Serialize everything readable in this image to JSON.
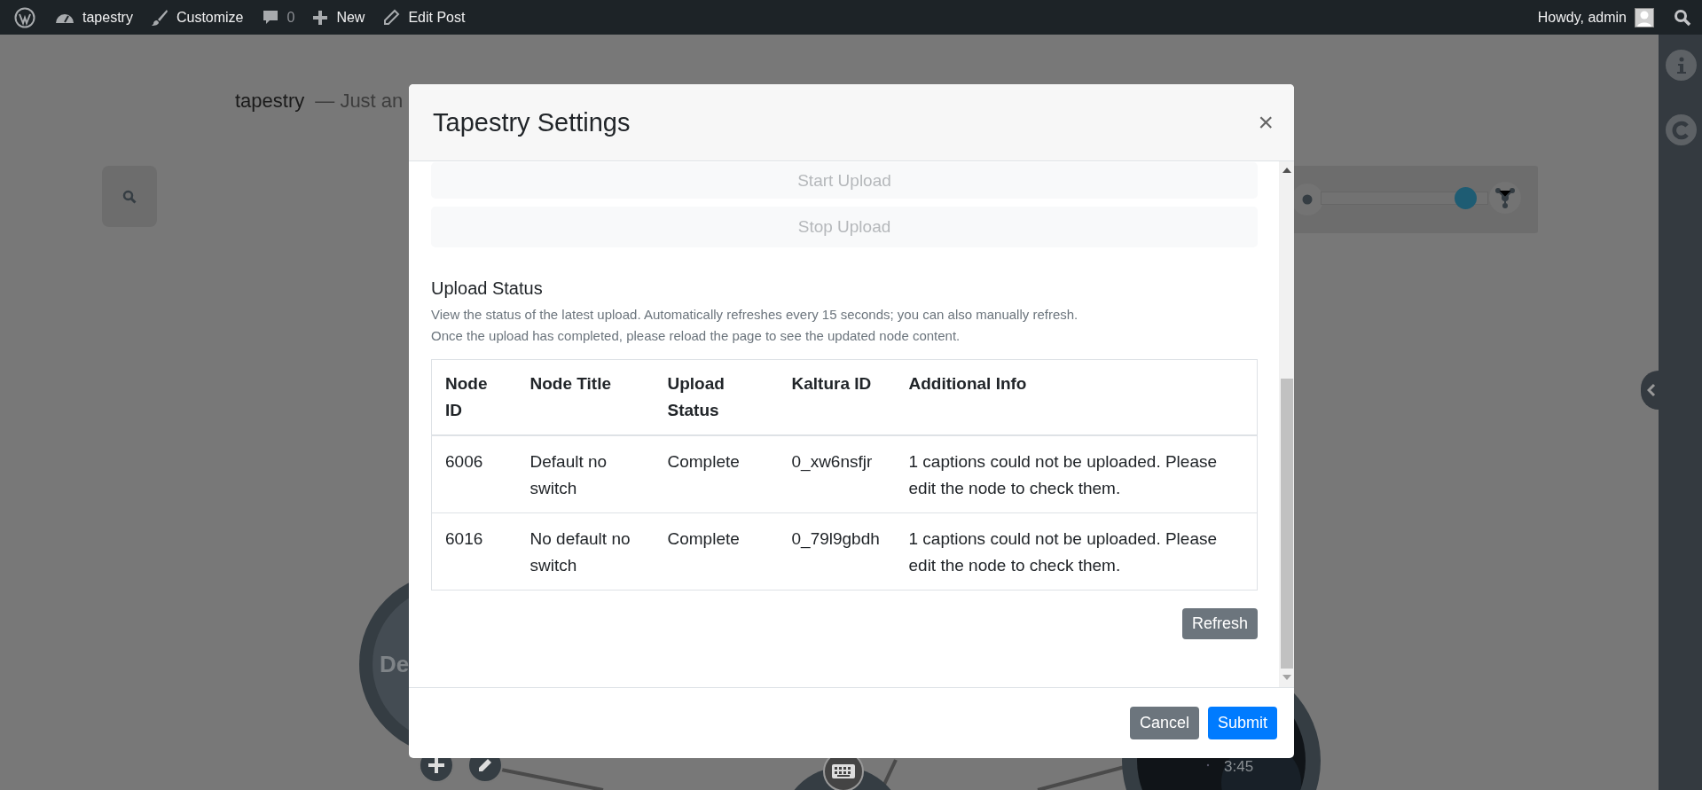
{
  "admin_bar": {
    "items": [
      {
        "kind": "logo"
      },
      {
        "kind": "site",
        "label": "tapestry"
      },
      {
        "kind": "customize",
        "label": "Customize"
      },
      {
        "kind": "comments",
        "label": "0"
      },
      {
        "kind": "new",
        "label": "New"
      },
      {
        "kind": "edit",
        "label": "Edit Post"
      }
    ],
    "greeting": "Howdy, admin"
  },
  "site": {
    "title": "tapestry",
    "tagline": "— Just an"
  },
  "canvas": {
    "depth_slider": {
      "level": 0.86
    },
    "nodes": [
      {
        "kind": "circle",
        "label": "De"
      },
      {
        "label": "3:45"
      }
    ]
  },
  "modal": {
    "title": "Tapestry Settings",
    "close": "×",
    "actions": [
      {
        "label": "Start Upload",
        "disabled": true
      },
      {
        "label": "Stop Upload",
        "disabled": true
      }
    ],
    "section_title": "Upload Status",
    "description": [
      "View the status of the latest upload. Automatically refreshes every 15 seconds; you can also manually refresh.",
      "Once the upload has completed, please reload the page to see the updated node content."
    ],
    "table": {
      "columns": [
        "Node ID",
        "Node Title",
        "Upload Status",
        "Kaltura ID",
        "Additional Info"
      ],
      "rows": [
        [
          "6006",
          "Default no switch",
          "Complete",
          "0_xw6nsfjr",
          "1 captions could not be uploaded. Please edit the node to check them."
        ],
        [
          "6016",
          "No default no switch",
          "Complete",
          "0_79l9gbdh",
          "1 captions could not be uploaded. Please edit the node to check them."
        ]
      ]
    },
    "refresh": "Refresh",
    "footer_buttons": [
      {
        "label": "Cancel",
        "kind": "secondary"
      },
      {
        "label": "Submit",
        "kind": "primary"
      }
    ]
  }
}
